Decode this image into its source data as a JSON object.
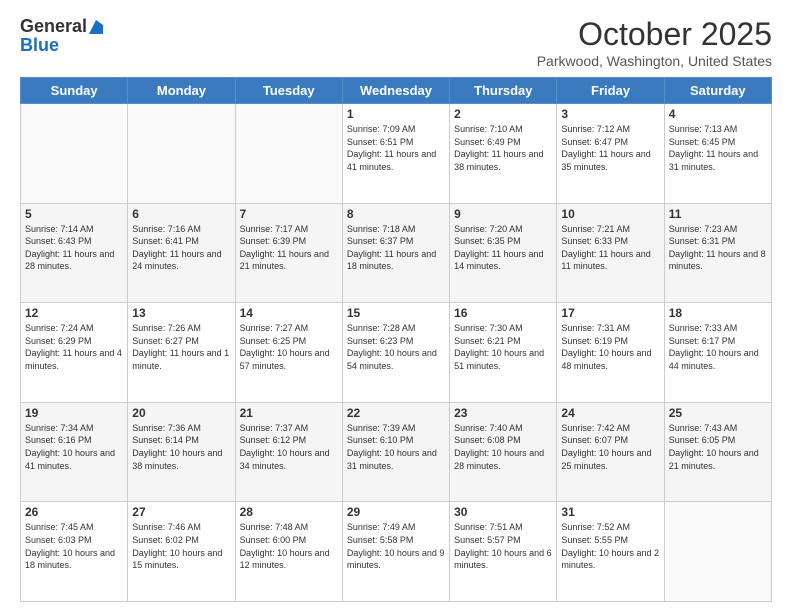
{
  "logo": {
    "general": "General",
    "blue": "Blue"
  },
  "header": {
    "month": "October 2025",
    "location": "Parkwood, Washington, United States"
  },
  "days": [
    "Sunday",
    "Monday",
    "Tuesday",
    "Wednesday",
    "Thursday",
    "Friday",
    "Saturday"
  ],
  "weeks": [
    [
      {
        "num": "",
        "text": ""
      },
      {
        "num": "",
        "text": ""
      },
      {
        "num": "",
        "text": ""
      },
      {
        "num": "1",
        "text": "Sunrise: 7:09 AM\nSunset: 6:51 PM\nDaylight: 11 hours and 41 minutes."
      },
      {
        "num": "2",
        "text": "Sunrise: 7:10 AM\nSunset: 6:49 PM\nDaylight: 11 hours and 38 minutes."
      },
      {
        "num": "3",
        "text": "Sunrise: 7:12 AM\nSunset: 6:47 PM\nDaylight: 11 hours and 35 minutes."
      },
      {
        "num": "4",
        "text": "Sunrise: 7:13 AM\nSunset: 6:45 PM\nDaylight: 11 hours and 31 minutes."
      }
    ],
    [
      {
        "num": "5",
        "text": "Sunrise: 7:14 AM\nSunset: 6:43 PM\nDaylight: 11 hours and 28 minutes."
      },
      {
        "num": "6",
        "text": "Sunrise: 7:16 AM\nSunset: 6:41 PM\nDaylight: 11 hours and 24 minutes."
      },
      {
        "num": "7",
        "text": "Sunrise: 7:17 AM\nSunset: 6:39 PM\nDaylight: 11 hours and 21 minutes."
      },
      {
        "num": "8",
        "text": "Sunrise: 7:18 AM\nSunset: 6:37 PM\nDaylight: 11 hours and 18 minutes."
      },
      {
        "num": "9",
        "text": "Sunrise: 7:20 AM\nSunset: 6:35 PM\nDaylight: 11 hours and 14 minutes."
      },
      {
        "num": "10",
        "text": "Sunrise: 7:21 AM\nSunset: 6:33 PM\nDaylight: 11 hours and 11 minutes."
      },
      {
        "num": "11",
        "text": "Sunrise: 7:23 AM\nSunset: 6:31 PM\nDaylight: 11 hours and 8 minutes."
      }
    ],
    [
      {
        "num": "12",
        "text": "Sunrise: 7:24 AM\nSunset: 6:29 PM\nDaylight: 11 hours and 4 minutes."
      },
      {
        "num": "13",
        "text": "Sunrise: 7:26 AM\nSunset: 6:27 PM\nDaylight: 11 hours and 1 minute."
      },
      {
        "num": "14",
        "text": "Sunrise: 7:27 AM\nSunset: 6:25 PM\nDaylight: 10 hours and 57 minutes."
      },
      {
        "num": "15",
        "text": "Sunrise: 7:28 AM\nSunset: 6:23 PM\nDaylight: 10 hours and 54 minutes."
      },
      {
        "num": "16",
        "text": "Sunrise: 7:30 AM\nSunset: 6:21 PM\nDaylight: 10 hours and 51 minutes."
      },
      {
        "num": "17",
        "text": "Sunrise: 7:31 AM\nSunset: 6:19 PM\nDaylight: 10 hours and 48 minutes."
      },
      {
        "num": "18",
        "text": "Sunrise: 7:33 AM\nSunset: 6:17 PM\nDaylight: 10 hours and 44 minutes."
      }
    ],
    [
      {
        "num": "19",
        "text": "Sunrise: 7:34 AM\nSunset: 6:16 PM\nDaylight: 10 hours and 41 minutes."
      },
      {
        "num": "20",
        "text": "Sunrise: 7:36 AM\nSunset: 6:14 PM\nDaylight: 10 hours and 38 minutes."
      },
      {
        "num": "21",
        "text": "Sunrise: 7:37 AM\nSunset: 6:12 PM\nDaylight: 10 hours and 34 minutes."
      },
      {
        "num": "22",
        "text": "Sunrise: 7:39 AM\nSunset: 6:10 PM\nDaylight: 10 hours and 31 minutes."
      },
      {
        "num": "23",
        "text": "Sunrise: 7:40 AM\nSunset: 6:08 PM\nDaylight: 10 hours and 28 minutes."
      },
      {
        "num": "24",
        "text": "Sunrise: 7:42 AM\nSunset: 6:07 PM\nDaylight: 10 hours and 25 minutes."
      },
      {
        "num": "25",
        "text": "Sunrise: 7:43 AM\nSunset: 6:05 PM\nDaylight: 10 hours and 21 minutes."
      }
    ],
    [
      {
        "num": "26",
        "text": "Sunrise: 7:45 AM\nSunset: 6:03 PM\nDaylight: 10 hours and 18 minutes."
      },
      {
        "num": "27",
        "text": "Sunrise: 7:46 AM\nSunset: 6:02 PM\nDaylight: 10 hours and 15 minutes."
      },
      {
        "num": "28",
        "text": "Sunrise: 7:48 AM\nSunset: 6:00 PM\nDaylight: 10 hours and 12 minutes."
      },
      {
        "num": "29",
        "text": "Sunrise: 7:49 AM\nSunset: 5:58 PM\nDaylight: 10 hours and 9 minutes."
      },
      {
        "num": "30",
        "text": "Sunrise: 7:51 AM\nSunset: 5:57 PM\nDaylight: 10 hours and 6 minutes."
      },
      {
        "num": "31",
        "text": "Sunrise: 7:52 AM\nSunset: 5:55 PM\nDaylight: 10 hours and 2 minutes."
      },
      {
        "num": "",
        "text": ""
      }
    ]
  ]
}
